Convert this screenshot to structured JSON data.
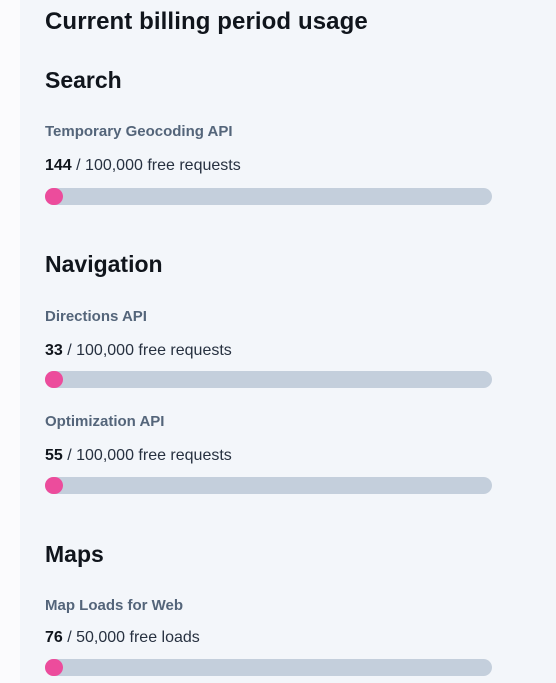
{
  "page_title": "Current billing period usage",
  "colors": {
    "progress_fill": "#ec4c9c",
    "progress_track": "#c4cfdc"
  },
  "sections": [
    {
      "title": "Search",
      "items": [
        {
          "name": "Temporary Geocoding API",
          "used": "144",
          "limit_text": " / 100,000 free requests",
          "used_fraction": 0.00144
        }
      ]
    },
    {
      "title": "Navigation",
      "items": [
        {
          "name": "Directions API",
          "used": "33",
          "limit_text": " / 100,000 free requests",
          "used_fraction": 0.00033
        },
        {
          "name": "Optimization API",
          "used": "55",
          "limit_text": " / 100,000 free requests",
          "used_fraction": 0.00055
        }
      ]
    },
    {
      "title": "Maps",
      "items": [
        {
          "name": "Map Loads for Web",
          "used": "76",
          "limit_text": " / 50,000 free loads",
          "used_fraction": 0.00152
        }
      ]
    }
  ]
}
